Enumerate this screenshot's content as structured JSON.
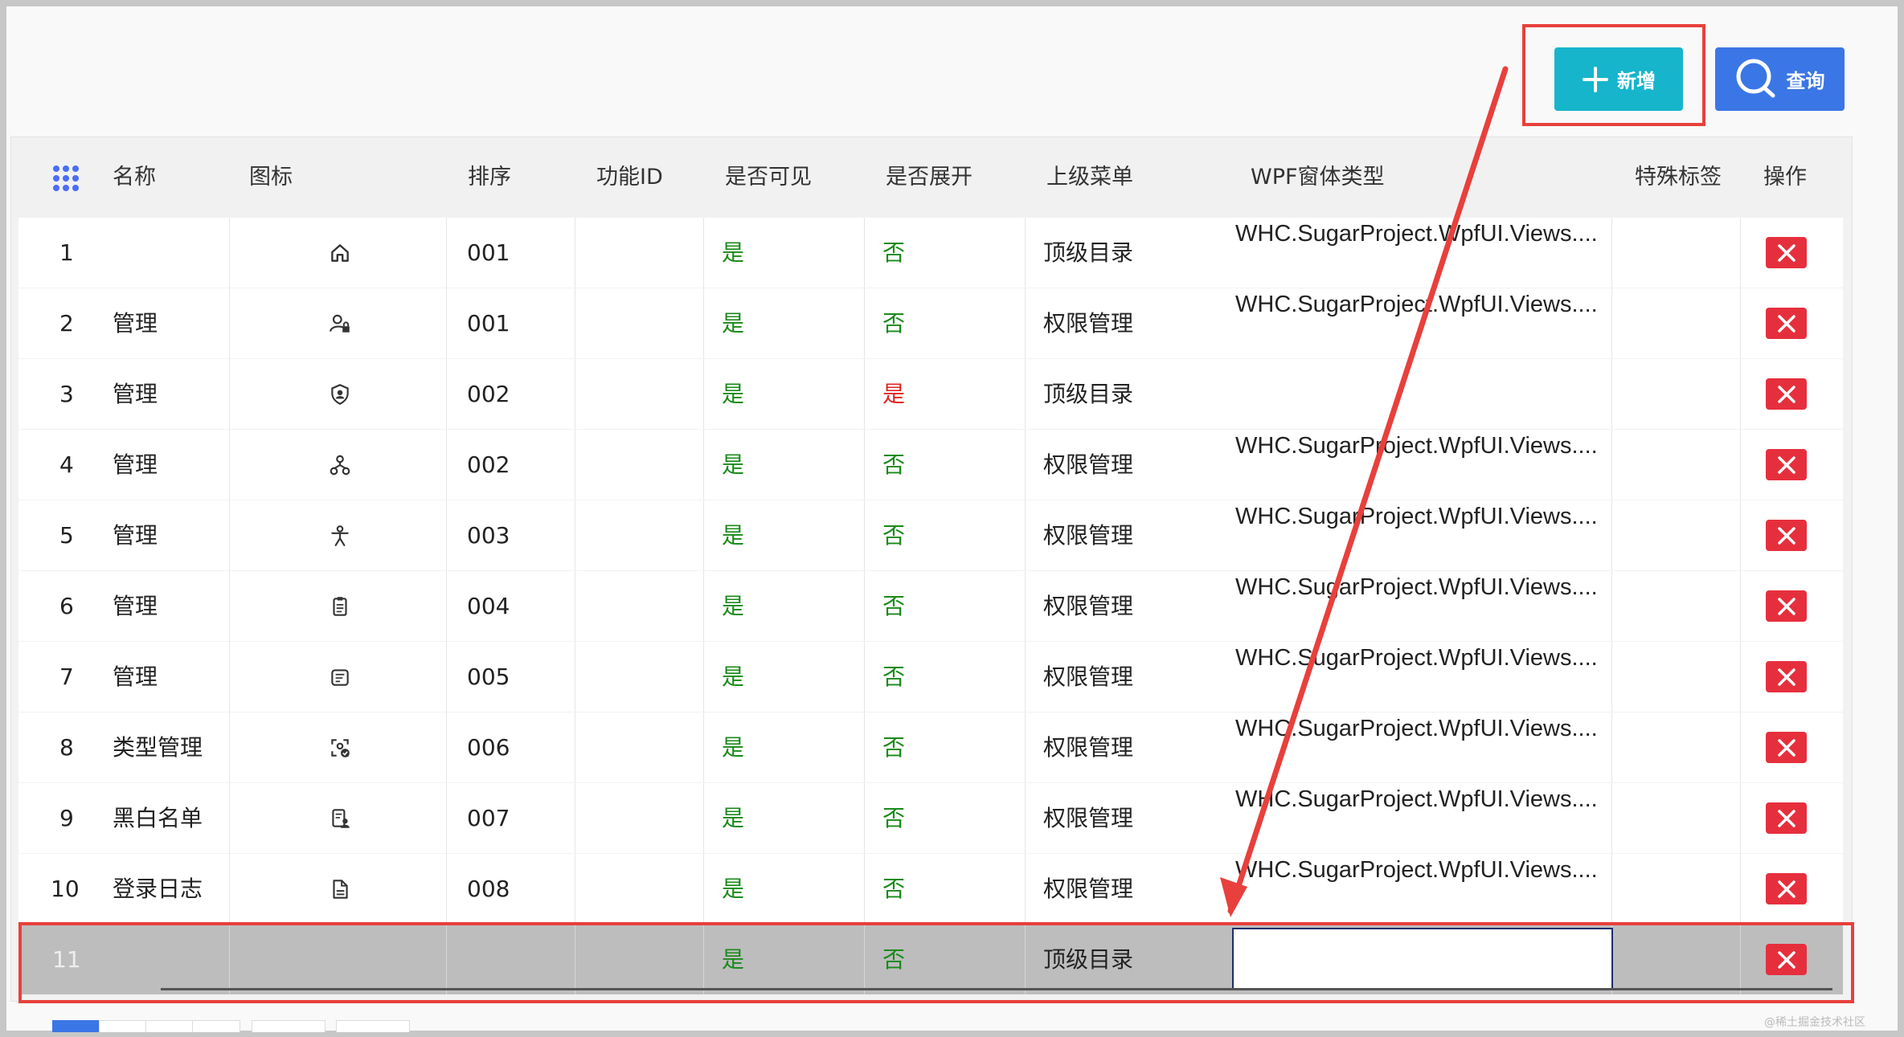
{
  "toolbar": {
    "add_label": "新增",
    "search_label": "查询"
  },
  "columns": [
    "名称",
    "图标",
    "排序",
    "功能ID",
    "是否可见",
    "是否展开",
    "上级菜单",
    "WPF窗体类型",
    "特殊标签",
    "操作"
  ],
  "rows": [
    {
      "index": "1",
      "name": "",
      "icon": "home-icon",
      "sort": "001",
      "func_id": "",
      "visible": "是",
      "expand": "否",
      "parent": "顶级目录",
      "wpf": "WHC.SugarProject.WpfUI.Views...."
    },
    {
      "index": "2",
      "name": "管理",
      "icon": "user-lock-icon",
      "sort": "001",
      "func_id": "",
      "visible": "是",
      "expand": "否",
      "parent": "权限管理",
      "wpf": "WHC.SugarProject.WpfUI.Views...."
    },
    {
      "index": "3",
      "name": "管理",
      "icon": "shield-user-icon",
      "sort": "002",
      "func_id": "",
      "visible": "是",
      "expand": "是",
      "parent": "顶级目录",
      "wpf": ""
    },
    {
      "index": "4",
      "name": "管理",
      "icon": "org-tree-icon",
      "sort": "002",
      "func_id": "",
      "visible": "是",
      "expand": "否",
      "parent": "权限管理",
      "wpf": "WHC.SugarProject.WpfUI.Views...."
    },
    {
      "index": "5",
      "name": "管理",
      "icon": "person-icon",
      "sort": "003",
      "func_id": "",
      "visible": "是",
      "expand": "否",
      "parent": "权限管理",
      "wpf": "WHC.SugarProject.WpfUI.Views...."
    },
    {
      "index": "6",
      "name": "管理",
      "icon": "clipboard-icon",
      "sort": "004",
      "func_id": "",
      "visible": "是",
      "expand": "否",
      "parent": "权限管理",
      "wpf": "WHC.SugarProject.WpfUI.Views...."
    },
    {
      "index": "7",
      "name": "管理",
      "icon": "list-box-icon",
      "sort": "005",
      "func_id": "",
      "visible": "是",
      "expand": "否",
      "parent": "权限管理",
      "wpf": "WHC.SugarProject.WpfUI.Views...."
    },
    {
      "index": "8",
      "name": "类型管理",
      "icon": "scan-check-icon",
      "sort": "006",
      "func_id": "",
      "visible": "是",
      "expand": "否",
      "parent": "权限管理",
      "wpf": "WHC.SugarProject.WpfUI.Views...."
    },
    {
      "index": "9",
      "name": "黑白名单",
      "icon": "doc-user-icon",
      "sort": "007",
      "func_id": "",
      "visible": "是",
      "expand": "否",
      "parent": "权限管理",
      "wpf": "WHC.SugarProject.WpfUI.Views...."
    },
    {
      "index": "10",
      "name": "登录日志",
      "icon": "document-icon",
      "sort": "008",
      "func_id": "",
      "visible": "是",
      "expand": "否",
      "parent": "权限管理",
      "wpf": "WHC.SugarProject.WpfUI.Views...."
    }
  ],
  "new_row": {
    "index": "11",
    "visible": "是",
    "expand": "否",
    "parent": "顶级目录",
    "wpf": ""
  },
  "watermark": "@稀土掘金技术社区",
  "colors": {
    "add_button": "#16b5cc",
    "search_button": "#3b76e6",
    "delete_button": "#e62f3d",
    "highlight_red": "#e8403c",
    "yes_green": "#1a8a1a"
  }
}
